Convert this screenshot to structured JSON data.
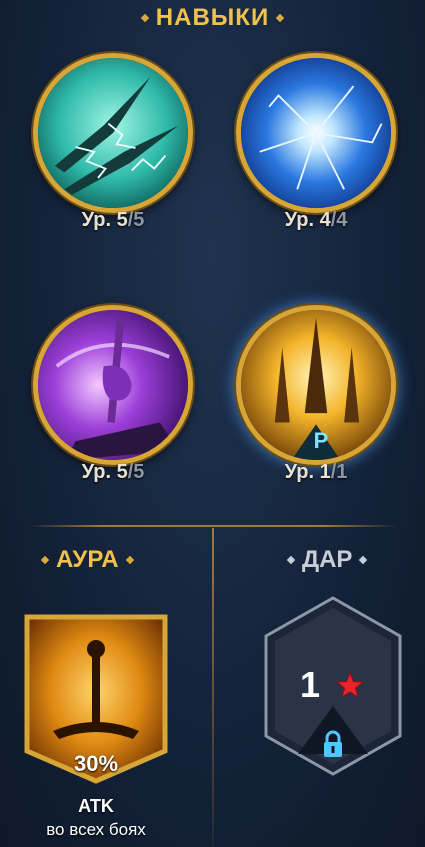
{
  "skills_section": {
    "title": "НАВЫКИ"
  },
  "skills": [
    {
      "name": "lightning-spears-skill",
      "level_prefix": "Ур. 5",
      "level_max": "/5"
    },
    {
      "name": "energy-orb-skill",
      "level_prefix": "Ур. 4",
      "level_max": "/4"
    },
    {
      "name": "purple-hand-skill",
      "level_prefix": "Ур. 5",
      "level_max": "/5"
    },
    {
      "name": "golden-spires-skill",
      "level_prefix": "Ур. 1",
      "level_max": "/1",
      "badge": "P"
    }
  ],
  "aura": {
    "title": "АУРА",
    "percent": "30%",
    "stat": "ATK",
    "scope": "во всех боях",
    "icon": "sword-icon"
  },
  "gift": {
    "title": "ДАР",
    "stars": "1",
    "star_icon": "red-star-icon",
    "lock_icon": "lock-icon"
  },
  "colors": {
    "gold_text": "#f0c14b",
    "gray_text": "#c9cdd6",
    "frame_gold": "#d7a636",
    "lock_blue": "#4fc7ff",
    "star_red": "#e8232b"
  }
}
